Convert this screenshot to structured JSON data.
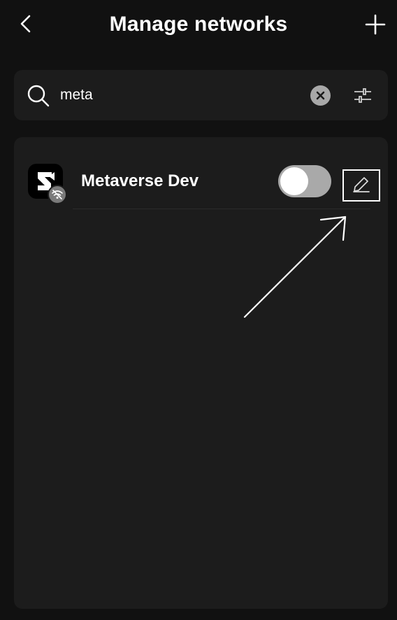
{
  "header": {
    "title": "Manage networks",
    "back_icon": "chevron-left-icon",
    "add_icon": "plus-icon"
  },
  "search": {
    "value": "meta",
    "search_icon": "search-icon",
    "clear_icon": "close-circle-icon",
    "filter_icon": "sliders-icon"
  },
  "networks": [
    {
      "name": "Metaverse Dev",
      "logo_icon": "network-logo-icon",
      "badge_icon": "testnet-badge-icon",
      "enabled": false,
      "edit_icon": "pencil-icon"
    }
  ],
  "colors": {
    "background": "#111111",
    "panel": "#1c1c1c",
    "toggle_off": "#a9a9a9",
    "text": "#ffffff"
  }
}
